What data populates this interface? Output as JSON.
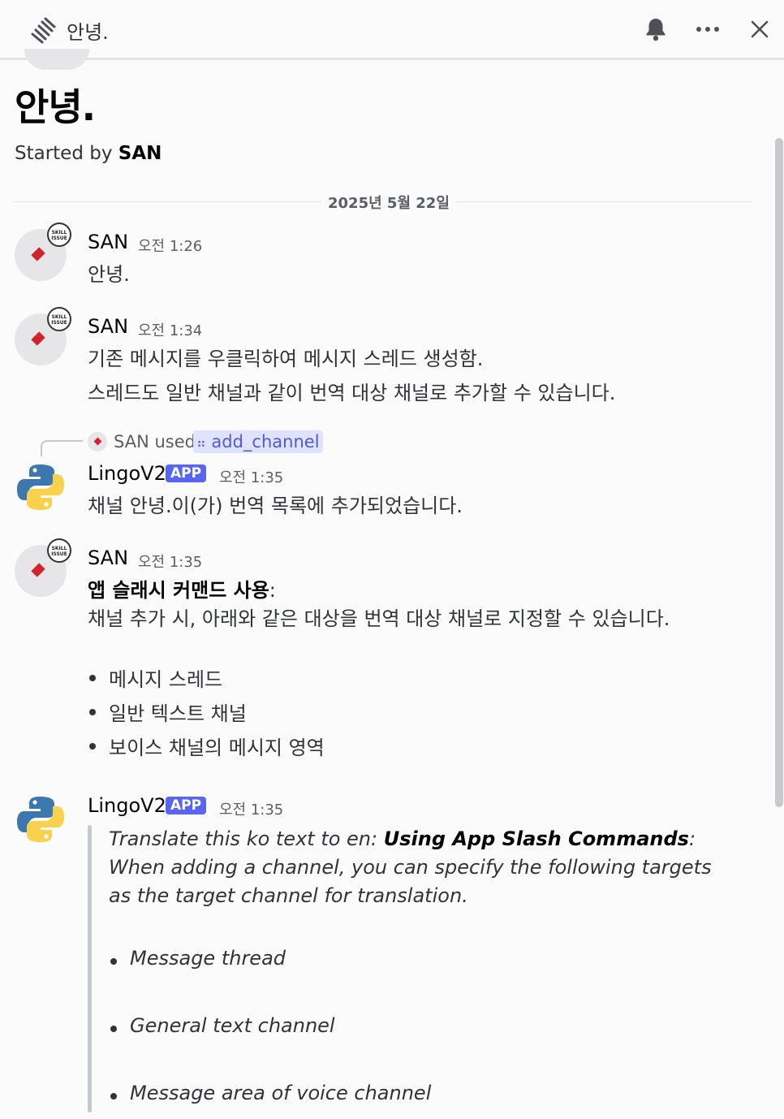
{
  "header": {
    "title": "안녕.",
    "icons": [
      "threads-icon",
      "bell-icon",
      "more-icon",
      "close-icon"
    ]
  },
  "thread": {
    "title": "안녕.",
    "started_prefix": "Started by",
    "started_by": "SAN"
  },
  "date_divider": "2025년 5월 22일",
  "messages": [
    {
      "author": "SAN",
      "time": "오전 1:26",
      "lines": [
        "안녕."
      ]
    },
    {
      "author": "SAN",
      "time": "오전 1:34",
      "lines": [
        "기존 메시지를 우클릭하여 메시지 스레드 생성함.",
        "스레드도 일반 채널과 같이 번역 대상 채널로 추가할 수 있습니다."
      ]
    },
    {
      "reply": {
        "user": "SAN",
        "used": "used",
        "command": "add_channel"
      },
      "author": "LingoV2",
      "tag": "APP",
      "time": "오전 1:35",
      "lines": [
        "채널 안녕.이(가) 번역 목록에 추가되었습니다."
      ]
    },
    {
      "author": "SAN",
      "time": "오전 1:35",
      "heading": "앱 슬래시 커맨드 사용",
      "heading_suffix": ":",
      "lines": [
        "채널 추가 시, 아래와 같은 대상을 번역 대상 채널로 지정할 수 있습니다."
      ],
      "bullets": [
        "메시지 스레드",
        "일반 텍스트 채널",
        "보이스 채널의 메시지 영역"
      ]
    },
    {
      "author": "LingoV2",
      "tag": "APP",
      "time": "오전 1:35",
      "quote": {
        "prefix": "Translate this ko text to en: ",
        "heading": "Using App Slash Commands",
        "heading_suffix": ":",
        "line2": "When adding a channel, you can specify the following targets",
        "line3": "as the target channel for translation.",
        "bullets": [
          "Message thread",
          "General text channel",
          "Message area of voice channel"
        ]
      }
    }
  ],
  "colors": {
    "brand": "#5865f2",
    "accent_red": "#d4222a"
  }
}
